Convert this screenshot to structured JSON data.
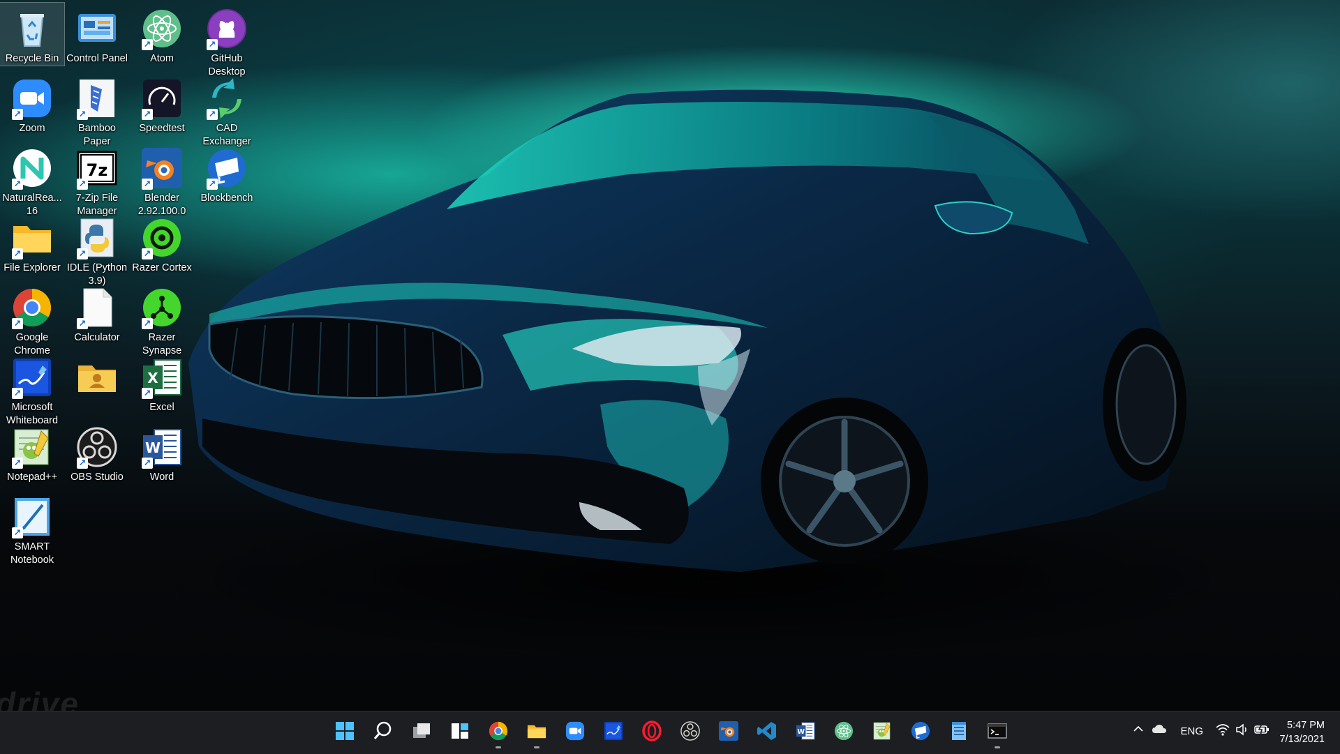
{
  "desktop": {
    "brand_watermark": "drive",
    "icons": [
      {
        "label": "Recycle Bin",
        "icon": "recycle-bin-icon",
        "shortcut": false,
        "selected": true
      },
      {
        "label": "Control Panel",
        "icon": "control-panel-icon",
        "shortcut": false
      },
      {
        "label": "Atom",
        "icon": "atom-icon",
        "shortcut": true
      },
      {
        "label": "GitHub Desktop",
        "icon": "github-icon",
        "shortcut": true
      },
      {
        "label": "Zoom",
        "icon": "zoom-icon",
        "shortcut": true
      },
      {
        "label": "Bamboo Paper",
        "icon": "bamboo-paper-icon",
        "shortcut": true
      },
      {
        "label": "Speedtest",
        "icon": "speedtest-icon",
        "shortcut": true
      },
      {
        "label": "CAD Exchanger",
        "icon": "cad-exchanger-icon",
        "shortcut": true
      },
      {
        "label": "NaturalRea... 16",
        "icon": "naturalreader-icon",
        "shortcut": true
      },
      {
        "label": "7-Zip File Manager",
        "icon": "7zip-icon",
        "shortcut": true
      },
      {
        "label": "Blender 2.92.100.0",
        "icon": "blender-icon",
        "shortcut": true
      },
      {
        "label": "Blockbench",
        "icon": "blockbench-icon",
        "shortcut": true
      },
      {
        "label": "File Explorer",
        "icon": "folder-icon",
        "shortcut": true
      },
      {
        "label": "IDLE (Python 3.9)",
        "icon": "python-idle-icon",
        "shortcut": true
      },
      {
        "label": "Razer Cortex",
        "icon": "razer-cortex-icon",
        "shortcut": true
      },
      {
        "label": "Google Chrome",
        "icon": "chrome-icon",
        "shortcut": true
      },
      {
        "label": "Calculator",
        "icon": "file-icon",
        "shortcut": true
      },
      {
        "label": "Razer Synapse",
        "icon": "razer-synapse-icon",
        "shortcut": true
      },
      {
        "label": "Microsoft Whiteboard",
        "icon": "whiteboard-icon",
        "shortcut": true
      },
      {
        "label": "",
        "icon": "user-folder-icon",
        "shortcut": false
      },
      {
        "label": "Excel",
        "icon": "excel-icon",
        "shortcut": true
      },
      {
        "label": "Notepad++",
        "icon": "notepadpp-icon",
        "shortcut": true
      },
      {
        "label": "OBS Studio",
        "icon": "obs-icon",
        "shortcut": true
      },
      {
        "label": "Word",
        "icon": "word-icon",
        "shortcut": true
      },
      {
        "label": "SMART Notebook",
        "icon": "smart-notebook-icon",
        "shortcut": true
      }
    ]
  },
  "taskbar": {
    "apps": [
      {
        "name": "start-button",
        "icon": "windows-logo-icon"
      },
      {
        "name": "search-button",
        "icon": "search-icon"
      },
      {
        "name": "task-view-button",
        "icon": "task-view-icon"
      },
      {
        "name": "widgets-button",
        "icon": "widgets-icon"
      },
      {
        "name": "chrome-taskbar-button",
        "icon": "chrome-icon",
        "running": true
      },
      {
        "name": "file-explorer-taskbar-button",
        "icon": "folder-icon",
        "running": true
      },
      {
        "name": "zoom-taskbar-button",
        "icon": "zoom-icon"
      },
      {
        "name": "whiteboard-taskbar-button",
        "icon": "whiteboard-icon"
      },
      {
        "name": "opera-taskbar-button",
        "icon": "opera-icon"
      },
      {
        "name": "obs-taskbar-button",
        "icon": "obs-icon"
      },
      {
        "name": "blender-taskbar-button",
        "icon": "blender-icon"
      },
      {
        "name": "vscode-taskbar-button",
        "icon": "vscode-icon"
      },
      {
        "name": "word-taskbar-button",
        "icon": "word-icon"
      },
      {
        "name": "atom-taskbar-button",
        "icon": "atom-icon"
      },
      {
        "name": "notepadpp-taskbar-button",
        "icon": "notepadpp-icon"
      },
      {
        "name": "blockbench-taskbar-button",
        "icon": "blockbench-icon"
      },
      {
        "name": "notepad-taskbar-button",
        "icon": "notepad-icon"
      },
      {
        "name": "terminal-taskbar-button",
        "icon": "terminal-icon",
        "running": true
      }
    ],
    "tray": {
      "language": "ENG",
      "time": "5:47 PM",
      "date": "7/13/2021"
    }
  },
  "colors": {
    "taskbar_bg": "#1c1e22",
    "accent_teal": "#3cffd7",
    "shortcut_arrow": "#1e6ad6"
  }
}
